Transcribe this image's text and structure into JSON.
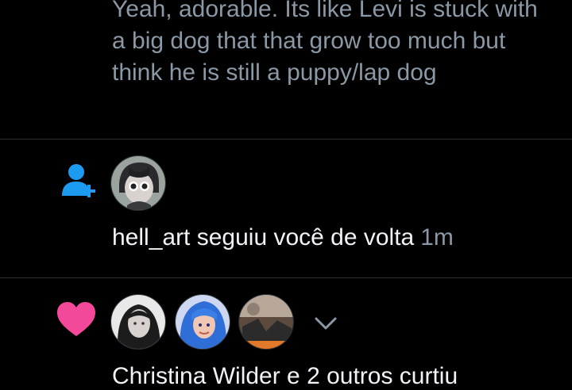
{
  "reply": {
    "text": "Yeah, adorable. Its like Levi is stuck with a big dog that that grow too much but think he is still a puppy/lap dog"
  },
  "follow_notification": {
    "text": "hell_art seguiu você de volta",
    "time": "1m",
    "icon": "person-plus-icon",
    "icon_color": "#1d9bf0"
  },
  "like_notification": {
    "text": "Christina Wilder e 2 outros curtiu",
    "icon": "heart-icon",
    "icon_color": "#f4489a"
  },
  "theme": {
    "background": "#000000",
    "primary_text": "#f1f3f5",
    "secondary_text": "#8b98a5",
    "divider": "#2b3036"
  }
}
